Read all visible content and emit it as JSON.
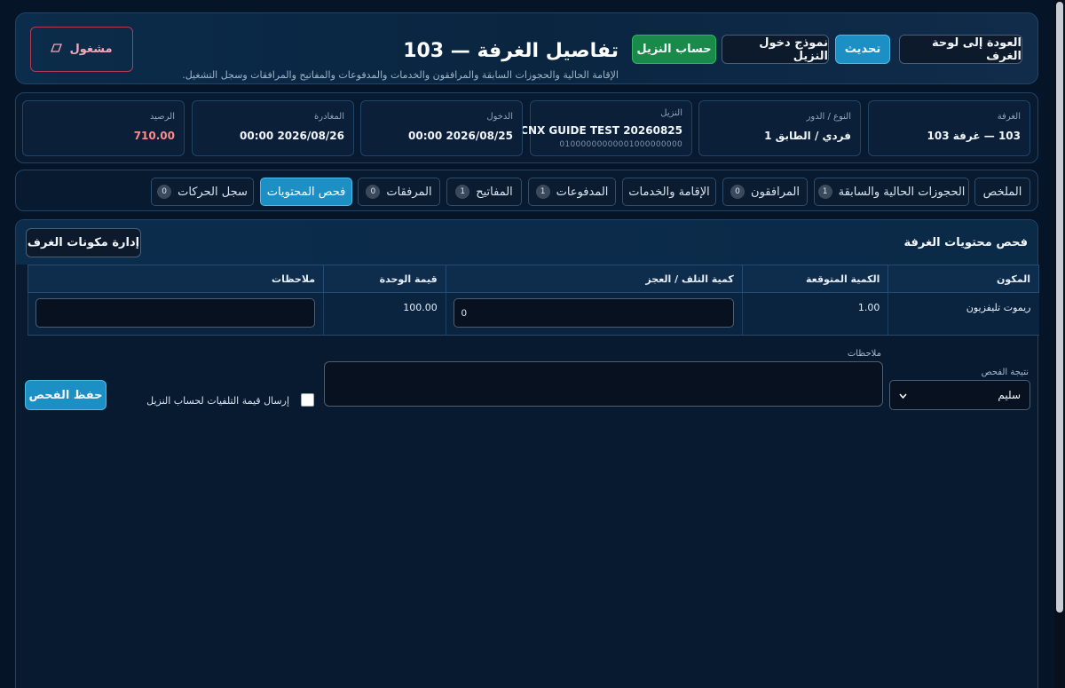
{
  "header": {
    "title": "تفاصيل الغرفة — 103",
    "subtitle": "الإقامة الحالية والحجوزات السابقة والمرافقون والخدمات والمدفوعات والمفاتيح والمرافقات وسجل التشغيل.",
    "back_label": "العودة إلى لوحة الغرف",
    "refresh_label": "تحديث",
    "checkin_form_label": "نموذج دخول النزيل",
    "guest_account_label": "حساب النزيل",
    "busy_label": "مشغول",
    "busy_icon": "eraser-icon"
  },
  "info": {
    "room_label": "الغرفة",
    "room_value": "103 — غرفة 103",
    "type_label": "النوع / الدور",
    "type_value": "فردي / الطابق 1",
    "guest_label": "النزيل",
    "guest_value": "CNX GUIDE TEST 20260825",
    "guest_id": "01000000000001000000000",
    "checkin_label": "الدخول",
    "checkin_value": "2026/08/25 00:00",
    "checkout_label": "المغادرة",
    "checkout_value": "2026/08/26 00:00",
    "balance_label": "الرصيد",
    "balance_value": "710.00",
    "balance_color": "#ff8a8a"
  },
  "tabs": [
    {
      "label": "الملخص",
      "badge": null
    },
    {
      "label": "الحجوزات الحالية والسابقة",
      "badge": "1"
    },
    {
      "label": "المرافقون",
      "badge": "0"
    },
    {
      "label": "الإقامة والخدمات",
      "badge": null
    },
    {
      "label": "المدفوعات",
      "badge": "1"
    },
    {
      "label": "المفاتيح",
      "badge": "1"
    },
    {
      "label": "المرفقات",
      "badge": "0"
    },
    {
      "label": "فحص المحتويات",
      "badge": null,
      "active": true
    },
    {
      "label": "سجل الحركات",
      "badge": "0"
    }
  ],
  "inspection": {
    "title": "فحص محتويات الغرفة",
    "manage_label": "إدارة مكونات الغرف",
    "columns": [
      "المكون",
      "الكمية المتوقعة",
      "كمية التلف / العجز",
      "قيمة الوحدة",
      "ملاحظات"
    ],
    "rows": [
      {
        "component": "ريموت تليفزيون",
        "expected": "1.00",
        "damage": "0",
        "unit_value": "100.00",
        "notes": ""
      }
    ],
    "result_label": "نتيجة الفحص",
    "result_value": "سليم",
    "notes_label": "ملاحظات",
    "send_label": "إرسال قيمة التلفيات لحساب النزيل",
    "save_label": "حفظ الفحص"
  }
}
